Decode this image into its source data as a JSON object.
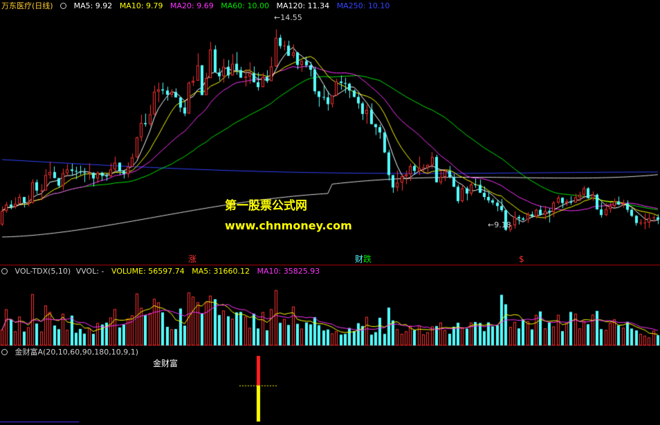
{
  "colors": {
    "background": "#000000",
    "up": "#ff3232",
    "down": "#54ffff",
    "ma5": "#ffffff",
    "ma10": "#ffff00",
    "ma20": "#ff33ff",
    "ma60": "#00e600",
    "ma120": "#e0e0e0",
    "ma250": "#3344ff",
    "divider": "#b00000"
  },
  "price_panel": {
    "title": "万东医疗(日线)",
    "indicators": [
      {
        "label": "MA5: 9.92",
        "color": "#ffffff"
      },
      {
        "label": "MA10: 9.79",
        "color": "#ffff00"
      },
      {
        "label": "MA20: 9.69",
        "color": "#ff33ff"
      },
      {
        "label": "MA60: 10.00",
        "color": "#00e600"
      },
      {
        "label": "MA120: 11.34",
        "color": "#ffffff"
      },
      {
        "label": "MA250: 10.10",
        "color": "#3344ff"
      }
    ],
    "high_label": "14.55",
    "low_label": "9.18",
    "event_markers": [
      {
        "text": "涨",
        "color": "#ff3232"
      },
      {
        "text": "财",
        "color": "#54ffff"
      },
      {
        "text": "跌",
        "color": "#00e600"
      },
      {
        "text": "$",
        "color": "#ff3232"
      }
    ]
  },
  "watermark": {
    "line1": "第一股票公式网",
    "line2": "www.chnmoney.com"
  },
  "volume_panel": {
    "indicators": [
      {
        "label": "VOL-TDX(5,10)",
        "color": "#d0d0d0"
      },
      {
        "label": "VVOL: -",
        "color": "#d0d0d0"
      },
      {
        "label": "VOLUME: 56597.74",
        "color": "#ffff00"
      },
      {
        "label": "MA5: 31660.12",
        "color": "#ffff00"
      },
      {
        "label": "MA10: 35825.93",
        "color": "#ff33ff"
      }
    ]
  },
  "signal_panel": {
    "indicator": "金财富A(20,10,60,90,180,10,9,1)",
    "signal_label": "金财富"
  },
  "chart_data": {
    "type": "candlestick",
    "ylim": [
      8.7,
      15.0
    ],
    "candles": [
      {
        "o": 9.38,
        "h": 9.86,
        "l": 9.34,
        "c": 9.74
      },
      {
        "o": 9.74,
        "h": 9.98,
        "l": 9.69,
        "c": 9.91
      },
      {
        "o": 9.91,
        "h": 10.02,
        "l": 9.78,
        "c": 9.85
      },
      {
        "o": 9.85,
        "h": 10.1,
        "l": 9.8,
        "c": 9.93
      },
      {
        "o": 9.93,
        "h": 10.19,
        "l": 9.93,
        "c": 10.11
      },
      {
        "o": 10.11,
        "h": 10.11,
        "l": 9.83,
        "c": 9.96
      },
      {
        "o": 9.96,
        "h": 10.16,
        "l": 9.86,
        "c": 9.96
      },
      {
        "o": 9.96,
        "h": 10.58,
        "l": 9.93,
        "c": 10.5
      },
      {
        "o": 10.5,
        "h": 10.57,
        "l": 10.19,
        "c": 10.28
      },
      {
        "o": 10.28,
        "h": 10.45,
        "l": 10.02,
        "c": 10.28
      },
      {
        "o": 10.28,
        "h": 10.85,
        "l": 10.28,
        "c": 10.69
      },
      {
        "o": 10.69,
        "h": 11.04,
        "l": 10.59,
        "c": 10.77
      },
      {
        "o": 10.77,
        "h": 10.92,
        "l": 10.61,
        "c": 10.61
      },
      {
        "o": 10.61,
        "h": 10.61,
        "l": 10.35,
        "c": 10.41
      },
      {
        "o": 10.41,
        "h": 10.86,
        "l": 10.29,
        "c": 10.74
      },
      {
        "o": 10.74,
        "h": 10.98,
        "l": 10.67,
        "c": 10.84
      },
      {
        "o": 10.84,
        "h": 10.99,
        "l": 10.67,
        "c": 10.8
      },
      {
        "o": 10.8,
        "h": 10.91,
        "l": 10.58,
        "c": 10.78
      },
      {
        "o": 10.78,
        "h": 10.94,
        "l": 10.69,
        "c": 10.76
      },
      {
        "o": 10.76,
        "h": 10.88,
        "l": 10.5,
        "c": 10.75
      },
      {
        "o": 10.75,
        "h": 11.0,
        "l": 10.57,
        "c": 10.75
      },
      {
        "o": 10.75,
        "h": 10.77,
        "l": 10.39,
        "c": 10.6
      },
      {
        "o": 10.6,
        "h": 10.79,
        "l": 10.48,
        "c": 10.75
      },
      {
        "o": 10.75,
        "h": 10.78,
        "l": 10.54,
        "c": 10.67
      },
      {
        "o": 10.67,
        "h": 10.74,
        "l": 10.54,
        "c": 10.66
      },
      {
        "o": 10.66,
        "h": 11.01,
        "l": 10.64,
        "c": 10.84
      },
      {
        "o": 10.84,
        "h": 11.18,
        "l": 10.79,
        "c": 11.02
      },
      {
        "o": 11.02,
        "h": 11.02,
        "l": 10.69,
        "c": 10.8
      },
      {
        "o": 10.8,
        "h": 10.8,
        "l": 10.6,
        "c": 10.72
      },
      {
        "o": 10.72,
        "h": 11.03,
        "l": 10.62,
        "c": 10.91
      },
      {
        "o": 10.91,
        "h": 11.26,
        "l": 10.91,
        "c": 11.16
      },
      {
        "o": 11.16,
        "h": 11.71,
        "l": 11.14,
        "c": 11.69
      },
      {
        "o": 11.69,
        "h": 12.29,
        "l": 11.58,
        "c": 12.07
      },
      {
        "o": 12.07,
        "h": 12.32,
        "l": 11.97,
        "c": 12.04
      },
      {
        "o": 12.04,
        "h": 12.55,
        "l": 11.99,
        "c": 12.3
      },
      {
        "o": 12.3,
        "h": 13.06,
        "l": 12.26,
        "c": 12.9
      },
      {
        "o": 12.9,
        "h": 13.14,
        "l": 12.62,
        "c": 12.96
      },
      {
        "o": 12.96,
        "h": 13.14,
        "l": 12.83,
        "c": 12.93
      },
      {
        "o": 12.93,
        "h": 13.03,
        "l": 12.66,
        "c": 12.82
      },
      {
        "o": 12.82,
        "h": 12.97,
        "l": 12.75,
        "c": 12.89
      },
      {
        "o": 12.89,
        "h": 12.99,
        "l": 12.74,
        "c": 12.75
      },
      {
        "o": 12.75,
        "h": 12.75,
        "l": 12.36,
        "c": 12.48
      },
      {
        "o": 12.48,
        "h": 12.64,
        "l": 12.25,
        "c": 12.32
      },
      {
        "o": 12.32,
        "h": 13.17,
        "l": 12.32,
        "c": 13.14
      },
      {
        "o": 13.14,
        "h": 13.31,
        "l": 13.05,
        "c": 13.19
      },
      {
        "o": 13.19,
        "h": 13.92,
        "l": 13.19,
        "c": 13.6
      },
      {
        "o": 13.6,
        "h": 13.6,
        "l": 12.81,
        "c": 12.81
      },
      {
        "o": 12.81,
        "h": 13.4,
        "l": 12.81,
        "c": 13.26
      },
      {
        "o": 13.26,
        "h": 14.22,
        "l": 13.26,
        "c": 14.02
      },
      {
        "o": 14.02,
        "h": 14.13,
        "l": 13.41,
        "c": 13.41
      },
      {
        "o": 13.41,
        "h": 13.52,
        "l": 13.19,
        "c": 13.31
      },
      {
        "o": 13.31,
        "h": 13.77,
        "l": 13.14,
        "c": 13.56
      },
      {
        "o": 13.56,
        "h": 13.74,
        "l": 13.25,
        "c": 13.33
      },
      {
        "o": 13.33,
        "h": 13.9,
        "l": 13.33,
        "c": 13.64
      },
      {
        "o": 13.64,
        "h": 13.95,
        "l": 13.35,
        "c": 13.47
      },
      {
        "o": 13.47,
        "h": 13.56,
        "l": 13.27,
        "c": 13.27
      },
      {
        "o": 13.27,
        "h": 13.5,
        "l": 13.04,
        "c": 13.3
      },
      {
        "o": 13.3,
        "h": 13.68,
        "l": 13.11,
        "c": 13.39
      },
      {
        "o": 13.39,
        "h": 13.57,
        "l": 13.14,
        "c": 13.15
      },
      {
        "o": 13.15,
        "h": 13.41,
        "l": 12.93,
        "c": 13.02
      },
      {
        "o": 13.02,
        "h": 13.4,
        "l": 13.02,
        "c": 13.29
      },
      {
        "o": 13.29,
        "h": 13.47,
        "l": 13.13,
        "c": 13.18
      },
      {
        "o": 13.18,
        "h": 13.82,
        "l": 13.18,
        "c": 13.57
      },
      {
        "o": 13.57,
        "h": 14.55,
        "l": 13.56,
        "c": 14.33
      },
      {
        "o": 14.33,
        "h": 14.41,
        "l": 14.04,
        "c": 14.11
      },
      {
        "o": 14.11,
        "h": 14.25,
        "l": 13.99,
        "c": 14.12
      },
      {
        "o": 14.12,
        "h": 14.25,
        "l": 13.85,
        "c": 13.85
      },
      {
        "o": 13.85,
        "h": 14.15,
        "l": 13.79,
        "c": 13.94
      },
      {
        "o": 13.94,
        "h": 13.95,
        "l": 13.49,
        "c": 13.61
      },
      {
        "o": 13.61,
        "h": 13.74,
        "l": 13.43,
        "c": 13.71
      },
      {
        "o": 13.71,
        "h": 13.83,
        "l": 13.54,
        "c": 13.6
      },
      {
        "o": 13.6,
        "h": 13.69,
        "l": 13.3,
        "c": 13.48
      },
      {
        "o": 13.48,
        "h": 13.56,
        "l": 12.83,
        "c": 12.91
      },
      {
        "o": 12.91,
        "h": 12.92,
        "l": 12.5,
        "c": 12.76
      },
      {
        "o": 12.76,
        "h": 13.06,
        "l": 12.67,
        "c": 12.75
      },
      {
        "o": 12.75,
        "h": 12.91,
        "l": 12.4,
        "c": 12.57
      },
      {
        "o": 12.57,
        "h": 12.8,
        "l": 12.48,
        "c": 12.8
      },
      {
        "o": 12.8,
        "h": 13.24,
        "l": 12.78,
        "c": 13.17
      },
      {
        "o": 13.17,
        "h": 13.33,
        "l": 12.95,
        "c": 13.13
      },
      {
        "o": 13.13,
        "h": 13.27,
        "l": 12.86,
        "c": 13.11
      },
      {
        "o": 13.11,
        "h": 13.14,
        "l": 12.73,
        "c": 12.93
      },
      {
        "o": 12.93,
        "h": 12.96,
        "l": 12.75,
        "c": 12.76
      },
      {
        "o": 12.76,
        "h": 12.85,
        "l": 12.45,
        "c": 12.59
      },
      {
        "o": 12.59,
        "h": 12.64,
        "l": 12.15,
        "c": 12.31
      },
      {
        "o": 12.31,
        "h": 12.55,
        "l": 12.05,
        "c": 12.42
      },
      {
        "o": 12.42,
        "h": 12.59,
        "l": 12.04,
        "c": 12.04
      },
      {
        "o": 12.04,
        "h": 12.04,
        "l": 11.75,
        "c": 11.96
      },
      {
        "o": 11.96,
        "h": 12.03,
        "l": 11.65,
        "c": 11.82
      },
      {
        "o": 11.82,
        "h": 11.82,
        "l": 11.27,
        "c": 11.29
      },
      {
        "o": 11.29,
        "h": 11.36,
        "l": 10.54,
        "c": 10.69
      },
      {
        "o": 10.69,
        "h": 10.69,
        "l": 10.22,
        "c": 10.36
      },
      {
        "o": 10.36,
        "h": 10.81,
        "l": 10.26,
        "c": 10.49
      },
      {
        "o": 10.49,
        "h": 10.72,
        "l": 10.28,
        "c": 10.66
      },
      {
        "o": 10.66,
        "h": 10.81,
        "l": 10.45,
        "c": 10.71
      },
      {
        "o": 10.71,
        "h": 11.0,
        "l": 10.53,
        "c": 10.93
      },
      {
        "o": 10.93,
        "h": 10.99,
        "l": 10.7,
        "c": 10.8
      },
      {
        "o": 10.8,
        "h": 11.18,
        "l": 10.69,
        "c": 10.87
      },
      {
        "o": 10.87,
        "h": 10.98,
        "l": 10.74,
        "c": 10.89
      },
      {
        "o": 10.89,
        "h": 10.98,
        "l": 10.72,
        "c": 10.96
      },
      {
        "o": 10.96,
        "h": 11.3,
        "l": 10.86,
        "c": 11.17
      },
      {
        "o": 11.17,
        "h": 11.23,
        "l": 10.49,
        "c": 10.5
      },
      {
        "o": 10.5,
        "h": 10.83,
        "l": 10.44,
        "c": 10.64
      },
      {
        "o": 10.64,
        "h": 10.84,
        "l": 10.53,
        "c": 10.8
      },
      {
        "o": 10.8,
        "h": 10.93,
        "l": 10.6,
        "c": 10.64
      },
      {
        "o": 10.64,
        "h": 10.72,
        "l": 10.37,
        "c": 10.38
      },
      {
        "o": 10.38,
        "h": 10.44,
        "l": 9.94,
        "c": 10.0
      },
      {
        "o": 10.0,
        "h": 10.43,
        "l": 9.96,
        "c": 10.34
      },
      {
        "o": 10.34,
        "h": 10.39,
        "l": 10.02,
        "c": 10.2
      },
      {
        "o": 10.2,
        "h": 10.52,
        "l": 10.14,
        "c": 10.44
      },
      {
        "o": 10.44,
        "h": 10.6,
        "l": 10.35,
        "c": 10.43
      },
      {
        "o": 10.43,
        "h": 10.57,
        "l": 10.22,
        "c": 10.22
      },
      {
        "o": 10.22,
        "h": 10.39,
        "l": 10.03,
        "c": 10.11
      },
      {
        "o": 10.11,
        "h": 10.25,
        "l": 9.95,
        "c": 10.02
      },
      {
        "o": 10.02,
        "h": 10.07,
        "l": 9.9,
        "c": 9.96
      },
      {
        "o": 9.96,
        "h": 10.04,
        "l": 9.73,
        "c": 9.87
      },
      {
        "o": 9.87,
        "h": 10.06,
        "l": 9.71,
        "c": 9.76
      },
      {
        "o": 9.76,
        "h": 9.78,
        "l": 9.21,
        "c": 9.24
      },
      {
        "o": 9.24,
        "h": 9.37,
        "l": 9.18,
        "c": 9.36
      },
      {
        "o": 9.36,
        "h": 9.73,
        "l": 9.27,
        "c": 9.58
      },
      {
        "o": 9.58,
        "h": 9.63,
        "l": 9.38,
        "c": 9.54
      },
      {
        "o": 9.54,
        "h": 9.58,
        "l": 9.48,
        "c": 9.51
      },
      {
        "o": 9.51,
        "h": 9.71,
        "l": 9.42,
        "c": 9.65
      },
      {
        "o": 9.65,
        "h": 9.73,
        "l": 9.57,
        "c": 9.59
      },
      {
        "o": 9.59,
        "h": 9.8,
        "l": 9.54,
        "c": 9.77
      },
      {
        "o": 9.77,
        "h": 9.88,
        "l": 9.62,
        "c": 9.64
      },
      {
        "o": 9.64,
        "h": 9.87,
        "l": 9.51,
        "c": 9.74
      },
      {
        "o": 9.74,
        "h": 9.81,
        "l": 9.43,
        "c": 9.71
      },
      {
        "o": 9.71,
        "h": 10.0,
        "l": 9.58,
        "c": 9.96
      },
      {
        "o": 9.96,
        "h": 10.15,
        "l": 9.92,
        "c": 10.09
      },
      {
        "o": 10.09,
        "h": 10.1,
        "l": 9.81,
        "c": 9.95
      },
      {
        "o": 9.95,
        "h": 10.05,
        "l": 9.87,
        "c": 9.99
      },
      {
        "o": 9.99,
        "h": 10.13,
        "l": 9.9,
        "c": 9.96
      },
      {
        "o": 9.96,
        "h": 10.2,
        "l": 9.96,
        "c": 10.1
      },
      {
        "o": 10.1,
        "h": 10.25,
        "l": 10.0,
        "c": 10.17
      },
      {
        "o": 10.17,
        "h": 10.4,
        "l": 10.07,
        "c": 10.34
      },
      {
        "o": 10.34,
        "h": 10.37,
        "l": 10.06,
        "c": 10.08
      },
      {
        "o": 10.08,
        "h": 10.26,
        "l": 10.01,
        "c": 10.17
      },
      {
        "o": 10.17,
        "h": 10.2,
        "l": 9.77,
        "c": 9.78
      },
      {
        "o": 9.78,
        "h": 9.97,
        "l": 9.56,
        "c": 9.63
      },
      {
        "o": 9.63,
        "h": 9.95,
        "l": 9.6,
        "c": 9.79
      },
      {
        "o": 9.79,
        "h": 9.97,
        "l": 9.69,
        "c": 9.87
      },
      {
        "o": 9.87,
        "h": 10.07,
        "l": 9.83,
        "c": 9.99
      },
      {
        "o": 9.99,
        "h": 10.12,
        "l": 9.89,
        "c": 9.91
      },
      {
        "o": 9.91,
        "h": 10.04,
        "l": 9.82,
        "c": 9.94
      },
      {
        "o": 9.94,
        "h": 10.02,
        "l": 9.7,
        "c": 9.77
      },
      {
        "o": 9.77,
        "h": 9.82,
        "l": 9.58,
        "c": 9.61
      },
      {
        "o": 9.61,
        "h": 9.63,
        "l": 9.35,
        "c": 9.42
      },
      {
        "o": 9.42,
        "h": 9.52,
        "l": 9.36,
        "c": 9.43
      },
      {
        "o": 9.43,
        "h": 9.68,
        "l": 9.25,
        "c": 9.43
      },
      {
        "o": 9.43,
        "h": 9.67,
        "l": 9.29,
        "c": 9.55
      },
      {
        "o": 9.55,
        "h": 9.63,
        "l": 9.45,
        "c": 9.57
      },
      {
        "o": 9.57,
        "h": 9.65,
        "l": 9.39,
        "c": 9.51
      }
    ],
    "volume_ylim": [
      0,
      60000
    ],
    "volumes": [
      13810,
      31520,
      22840,
      12370,
      25060,
      12100,
      15890,
      44620,
      19070,
      12140,
      34810,
      29140,
      17400,
      14200,
      27620,
      13640,
      26000,
      11100,
      14390,
      10340,
      14810,
      10170,
      19510,
      18250,
      19860,
      24390,
      31620,
      15710,
      18350,
      23410,
      26270,
      45170,
      32730,
      26470,
      28260,
      40600,
      37490,
      28770,
      16250,
      14140,
      14330,
      32100,
      17290,
      46040,
      42460,
      37530,
      27790,
      37500,
      43300,
      40230,
      26510,
      30420,
      25410,
      23290,
      28760,
      29160,
      25050,
      15410,
      27670,
      14820,
      29040,
      13220,
      31580,
      48160,
      19690,
      22980,
      17840,
      33820,
      18850,
      14700,
      20000,
      18340,
      24630,
      17660,
      13050,
      13880,
      10590,
      12370,
      9450,
      10090,
      15260,
      12560,
      19400,
      16950,
      24820,
      9420,
      11630,
      24110,
      10100,
      32940,
      21800,
      14240,
      10150,
      12380,
      17210,
      13470,
      17240,
      9620,
      11580,
      16640,
      16900,
      19930,
      13470,
      10210,
      16310,
      19790,
      15840,
      14660,
      19950,
      20430,
      19590,
      12490,
      20090,
      16670,
      17640,
      44040,
      35820,
      16180,
      20450,
      14870,
      22710,
      21080,
      13970,
      26640,
      29600,
      14870,
      19860,
      16570,
      26650,
      12500,
      19240,
      29190,
      27690,
      14860,
      21390,
      18510,
      26860,
      30080,
      14270,
      13550,
      19820,
      22780,
      17500,
      15510,
      20600,
      14740,
      13130,
      10210,
      8580,
      7010,
      12930,
      9010
    ],
    "signal_bar": {
      "index": 59,
      "red_top": 1.0,
      "yellow_top": 0.55
    }
  }
}
